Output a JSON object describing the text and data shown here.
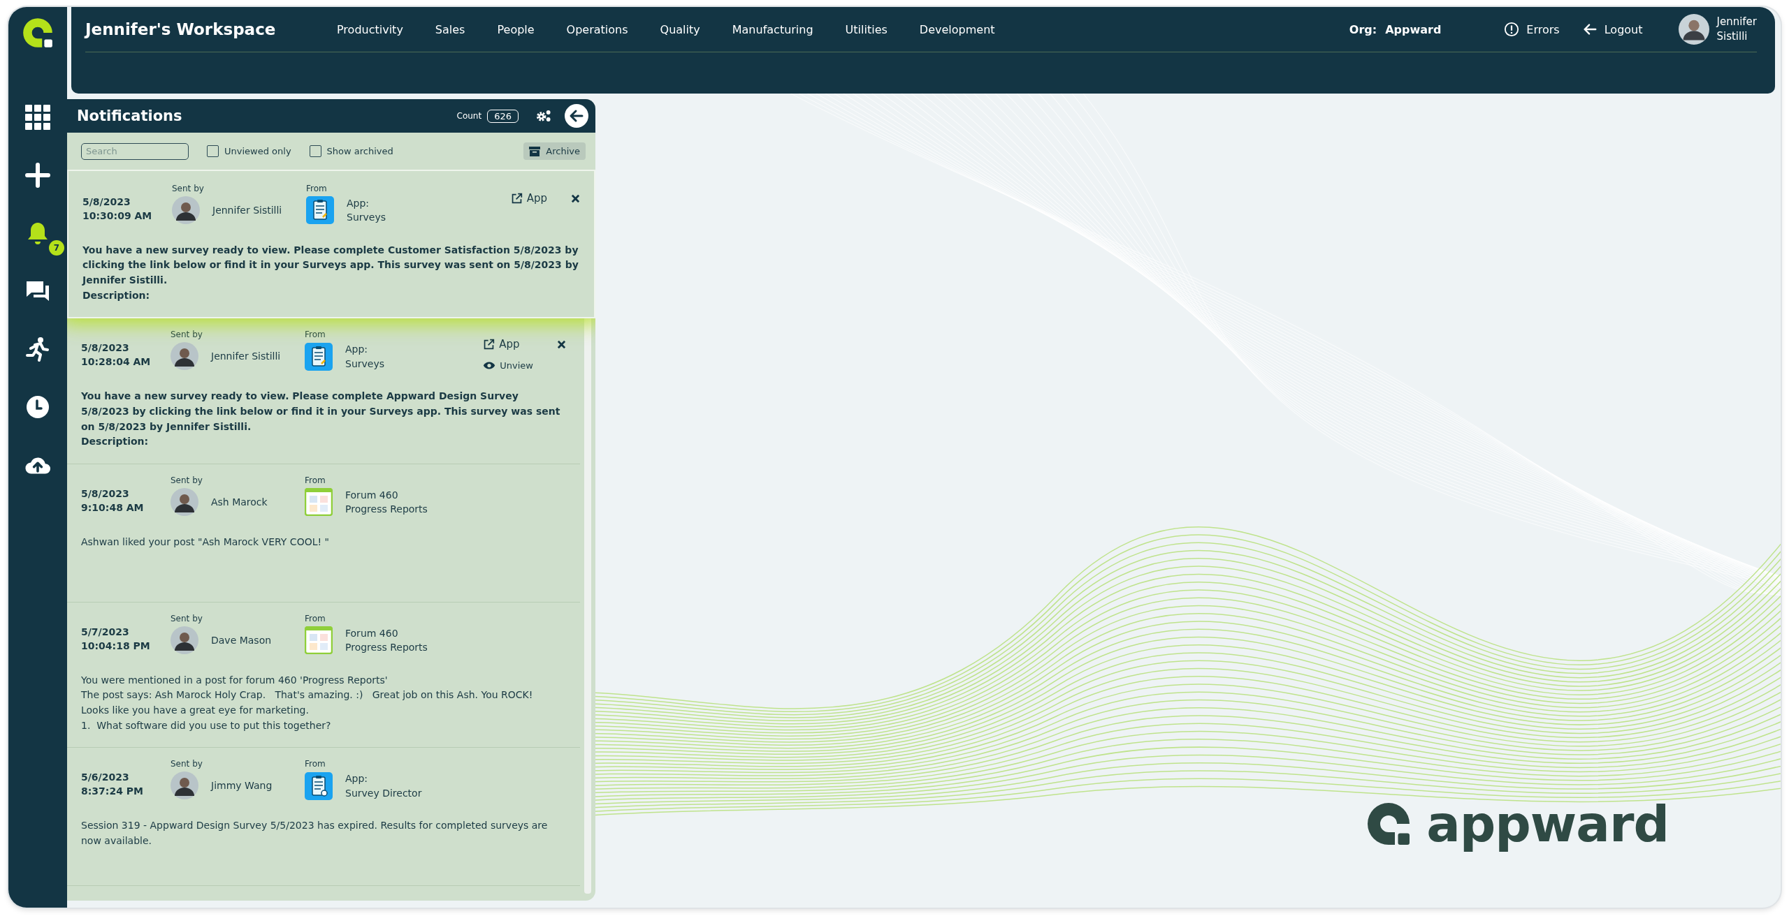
{
  "workspace": {
    "title": "Jennifer's Workspace"
  },
  "nav": [
    "Productivity",
    "Sales",
    "People",
    "Operations",
    "Quality",
    "Manufacturing",
    "Utilities",
    "Development"
  ],
  "org": {
    "label": "Org:",
    "value": "Appward"
  },
  "header_actions": [
    {
      "kind": "errors",
      "label": "Errors"
    },
    {
      "kind": "logout",
      "label": "Logout"
    }
  ],
  "user": {
    "first_name": "Jennifer",
    "last_name": "Sistilli"
  },
  "sidebar": {
    "notification_badge": "7"
  },
  "notifications": {
    "title": "Notifications",
    "count_label": "Count",
    "count": "626",
    "search_placeholder": "Search",
    "filters": [
      {
        "label": "Unviewed only",
        "checked": false
      },
      {
        "label": "Show archived",
        "checked": false
      }
    ],
    "archive_label": "Archive",
    "items": [
      {
        "date": "5/8/2023",
        "time": "10:30:09 AM",
        "sent_by_label": "Sent by",
        "sender": "Jennifer Sistilli",
        "from_label": "From",
        "kind": "survey",
        "source": [
          "App:",
          "Surveys"
        ],
        "message": [
          "You have a new survey ready to view. Please complete Customer Satisfaction 5/8/2023 by clicking the link below or find it in your Surveys app. This survey was sent on 5/8/2023 by Jennifer Sistilli.",
          "Description:"
        ],
        "bold": true,
        "highlighted": true,
        "app_link": "App",
        "closable": true
      },
      {
        "date": "5/8/2023",
        "time": "10:28:04 AM",
        "sent_by_label": "Sent by",
        "sender": "Jennifer Sistilli",
        "from_label": "From",
        "kind": "survey",
        "source": [
          "App:",
          "Surveys"
        ],
        "message": [
          "You have a new survey ready to view. Please complete Appward Design Survey 5/8/2023 by clicking the link below or find it in your Surveys app. This survey was sent on 5/8/2023 by Jennifer Sistilli.",
          "Description:"
        ],
        "bold": true,
        "highlighted": false,
        "app_link": "App",
        "closable": true,
        "unview": "Unview"
      },
      {
        "date": "5/8/2023",
        "time": "9:10:48 AM",
        "sent_by_label": "Sent by",
        "sender": "Ash Marock",
        "from_label": "From",
        "kind": "forum",
        "source": [
          "Forum 460",
          "Progress Reports"
        ],
        "message": [
          "Ashwan liked your post \"Ash Marock VERY COOL! \""
        ],
        "bold": false,
        "highlighted": false,
        "closable": false
      },
      {
        "date": "5/7/2023",
        "time": "10:04:18 PM",
        "sent_by_label": "Sent by",
        "sender": "Dave Mason",
        "from_label": "From",
        "kind": "forum",
        "source": [
          "Forum 460",
          "Progress Reports"
        ],
        "message": [
          "You were mentioned in a post for forum 460 'Progress Reports'",
          "The post says: Ash Marock Holy Crap.   That's amazing. :)   Great job on this Ash. You ROCK!",
          "Looks like you have a great eye for marketing.",
          "1.  What software did you use to put this together?"
        ],
        "bold": false,
        "highlighted": false,
        "closable": false
      },
      {
        "date": "5/6/2023",
        "time": "8:37:24 PM",
        "sent_by_label": "Sent by",
        "sender": "Jimmy Wang",
        "from_label": "From",
        "kind": "director",
        "source": [
          "App:",
          "Survey Director"
        ],
        "message": [
          "Session 319 - Appward Design Survey 5/5/2023 has expired. Results for completed surveys are now available."
        ],
        "bold": false,
        "highlighted": false,
        "closable": false
      }
    ]
  },
  "brand": {
    "name": "appward"
  }
}
